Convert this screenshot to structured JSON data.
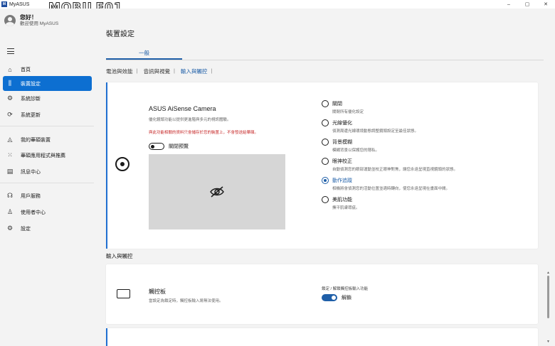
{
  "window": {
    "app_icon_text": "M",
    "title": "MyASUS",
    "watermark": "MOBILE01",
    "controls": {
      "minimize": "–",
      "maximize": "▢",
      "close": "✕"
    }
  },
  "user": {
    "greeting": "您好！",
    "welcome": "歡迎使用 MyASUS"
  },
  "sidebar": {
    "items": [
      {
        "label": "首頁",
        "icon": "home-icon",
        "glyph": "⌂"
      },
      {
        "label": "裝置設定",
        "icon": "sliders-icon",
        "glyph": "⫼"
      },
      {
        "label": "系統診斷",
        "icon": "diagnostics-icon",
        "glyph": "⚙"
      },
      {
        "label": "系統更新",
        "icon": "update-icon",
        "glyph": "⟳"
      },
      {
        "label": "我的華碩裝置",
        "icon": "device-icon",
        "glyph": "◬"
      },
      {
        "label": "華碩應用程式與推薦",
        "icon": "apps-grid-icon",
        "glyph": "⁙"
      },
      {
        "label": "訊息中心",
        "icon": "message-icon",
        "glyph": "▤"
      },
      {
        "label": "用戶服務",
        "icon": "headset-icon",
        "glyph": "☊"
      },
      {
        "label": "使用者中心",
        "icon": "user-icon",
        "glyph": "♙"
      },
      {
        "label": "設定",
        "icon": "settings-gear-icon",
        "glyph": "⚙"
      }
    ],
    "active_index": 1
  },
  "main": {
    "page_title": "裝置設定",
    "tab_general": "一般",
    "subtabs": [
      {
        "label": "電池與效能"
      },
      {
        "label": "音訊與視覺"
      },
      {
        "label": "輸入與觸控"
      }
    ],
    "subtab_separator": "|",
    "selected_subtab_index": 2
  },
  "camera": {
    "title": "ASUS AiSense Camera",
    "description": "優化鏡頭功能以提供更進階與多元的視訊體驗。",
    "warning": "與此功能相關的資料只會儲存於您的裝置上，不會發送給華碩。",
    "preview_toggle_label": "關閉預覽",
    "preview_toggle_on": false,
    "preview_icon": "eye-off-icon",
    "options": [
      {
        "label": "關閉",
        "desc": "關閉所有優化設定",
        "checked": false
      },
      {
        "label": "光線優化",
        "desc": "偵測周遭光線環境動態調整鏡頭設定至最佳狀態。",
        "checked": false
      },
      {
        "label": "背景模糊",
        "desc": "模糊背景以保護您的隱私。",
        "checked": false
      },
      {
        "label": "眼神校正",
        "desc": "自動偵測您的眼部運動並校正眼神對焦，讓您永遠呈現直視鏡頭的狀態。",
        "checked": false
      },
      {
        "label": "動作追蹤",
        "desc": "相機將會偵測您的活動位置並適時轉向，使您永遠呈現在畫面中間。",
        "checked": true
      },
      {
        "label": "美肌功能",
        "desc": "撫平肌膚瑕疵。",
        "checked": false
      }
    ]
  },
  "input_section": {
    "title": "輸入與觸控",
    "touchpad": {
      "title": "觸控板",
      "description": "當設定為鎖定時，觸控板輸入將無法使用。",
      "control_label": "鎖定 / 解鎖觸控板輸入功能",
      "toggle_label": "解鎖",
      "toggle_on": true
    }
  },
  "colors": {
    "accent": "#1f5fa8",
    "nav_active": "#0d6fd1",
    "warning": "#c62828"
  }
}
